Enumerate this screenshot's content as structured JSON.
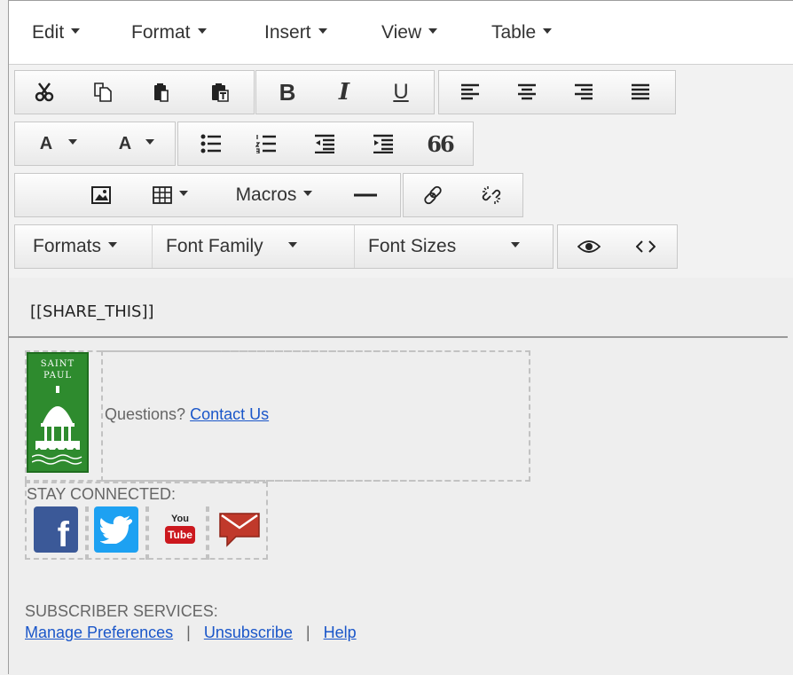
{
  "menubar": {
    "items": [
      {
        "label": "Edit"
      },
      {
        "label": "Format"
      },
      {
        "label": "Insert"
      },
      {
        "label": "View"
      },
      {
        "label": "Table"
      }
    ]
  },
  "toolbar": {
    "row1": {
      "clipboard": [
        "cut-icon",
        "copy-icon",
        "paste-icon",
        "paste-as-text-icon"
      ],
      "bold_label": "B",
      "italic_label": "I",
      "underline_label": "U",
      "align": [
        "align-left-icon",
        "align-center-icon",
        "align-right-icon",
        "justify-icon"
      ]
    },
    "row2": {
      "text_color_label": "A",
      "bg_color_label": "A",
      "quote_label": "66"
    },
    "row3": {
      "macros_label": "Macros"
    },
    "row4": {
      "formats_label": "Formats",
      "font_family_label": "Font Family",
      "font_sizes_label": "Font Sizes"
    }
  },
  "content": {
    "share_this": "[[SHARE_THIS]]",
    "logo_line1": "SAINT",
    "logo_line2": "PAUL",
    "questions_text": "Questions?",
    "contact_link": "Contact Us",
    "stay_connected": "STAY CONNECTED:",
    "youtube_top": "You",
    "youtube_bottom": "Tube",
    "subscriber_services": "SUBSCRIBER SERVICES:",
    "links": {
      "manage": "Manage Preferences",
      "unsubscribe": "Unsubscribe",
      "help": "Help",
      "separator": "|"
    }
  },
  "colors": {
    "link": "#1a56c9",
    "logo_green": "#2e8b2e",
    "facebook": "#3b5998",
    "twitter": "#1da1f2",
    "youtube": "#cc181e",
    "email": "#c0392b"
  }
}
